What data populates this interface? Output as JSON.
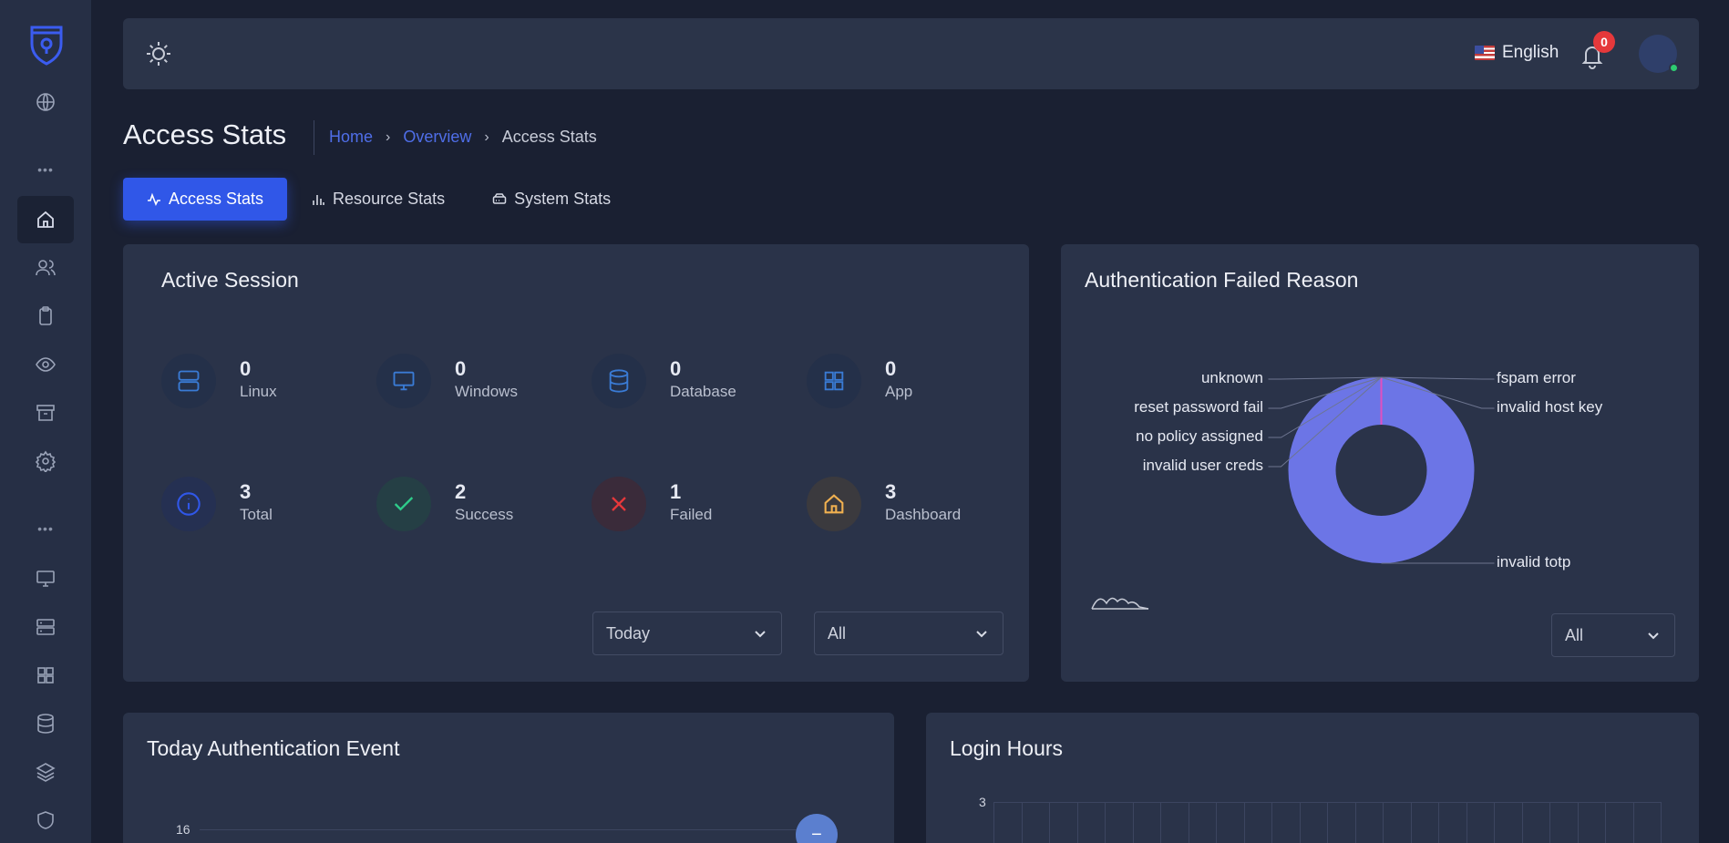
{
  "header": {
    "language": "English",
    "notification_count": "0"
  },
  "page": {
    "title": "Access Stats",
    "breadcrumb": [
      "Home",
      "Overview",
      "Access Stats"
    ]
  },
  "tabs": [
    {
      "label": "Access Stats",
      "icon": "activity-icon",
      "active": true
    },
    {
      "label": "Resource Stats",
      "icon": "bar-chart-icon",
      "active": false
    },
    {
      "label": "System Stats",
      "icon": "hard-drive-icon",
      "active": false
    }
  ],
  "active_session": {
    "title": "Active Session",
    "stats": [
      {
        "value": "0",
        "label": "Linux",
        "icon": "server-icon",
        "color": "#3a7bd5"
      },
      {
        "value": "0",
        "label": "Windows",
        "icon": "monitor-icon",
        "color": "#3a7bd5"
      },
      {
        "value": "0",
        "label": "Database",
        "icon": "database-icon",
        "color": "#3a7bd5"
      },
      {
        "value": "0",
        "label": "App",
        "icon": "grid-icon",
        "color": "#3a7bd5"
      },
      {
        "value": "3",
        "label": "Total",
        "icon": "info-icon",
        "color": "#3057e8"
      },
      {
        "value": "2",
        "label": "Success",
        "icon": "check-icon",
        "color": "#2ecc8a"
      },
      {
        "value": "1",
        "label": "Failed",
        "icon": "x-icon",
        "color": "#e5383b"
      },
      {
        "value": "3",
        "label": "Dashboard",
        "icon": "home-icon",
        "color": "#f0b050"
      }
    ],
    "period_select": "Today",
    "type_select": "All"
  },
  "auth_failed": {
    "title": "Authentication Failed Reason",
    "select": "All"
  },
  "chart_data": [
    {
      "type": "pie",
      "title": "Authentication Failed Reason",
      "categories": [
        "unknown",
        "reset password fail",
        "no policy assigned",
        "invalid user creds",
        "fspam error",
        "invalid host key",
        "invalid totp"
      ],
      "values": [
        0,
        0,
        0,
        0,
        0,
        0,
        1
      ],
      "colors": [
        "#6c75e6",
        "#6c75e6",
        "#6c75e6",
        "#6c75e6",
        "#6c75e6",
        "#e04fbf",
        "#6c75e6"
      ],
      "donut": true
    }
  ],
  "today_auth": {
    "title": "Today Authentication Event",
    "y_tick": "16"
  },
  "login_hours": {
    "title": "Login Hours",
    "y_tick": "3"
  },
  "colors": {
    "accent": "#3057e8",
    "background": "#1a2032",
    "card": "#2a3349"
  }
}
